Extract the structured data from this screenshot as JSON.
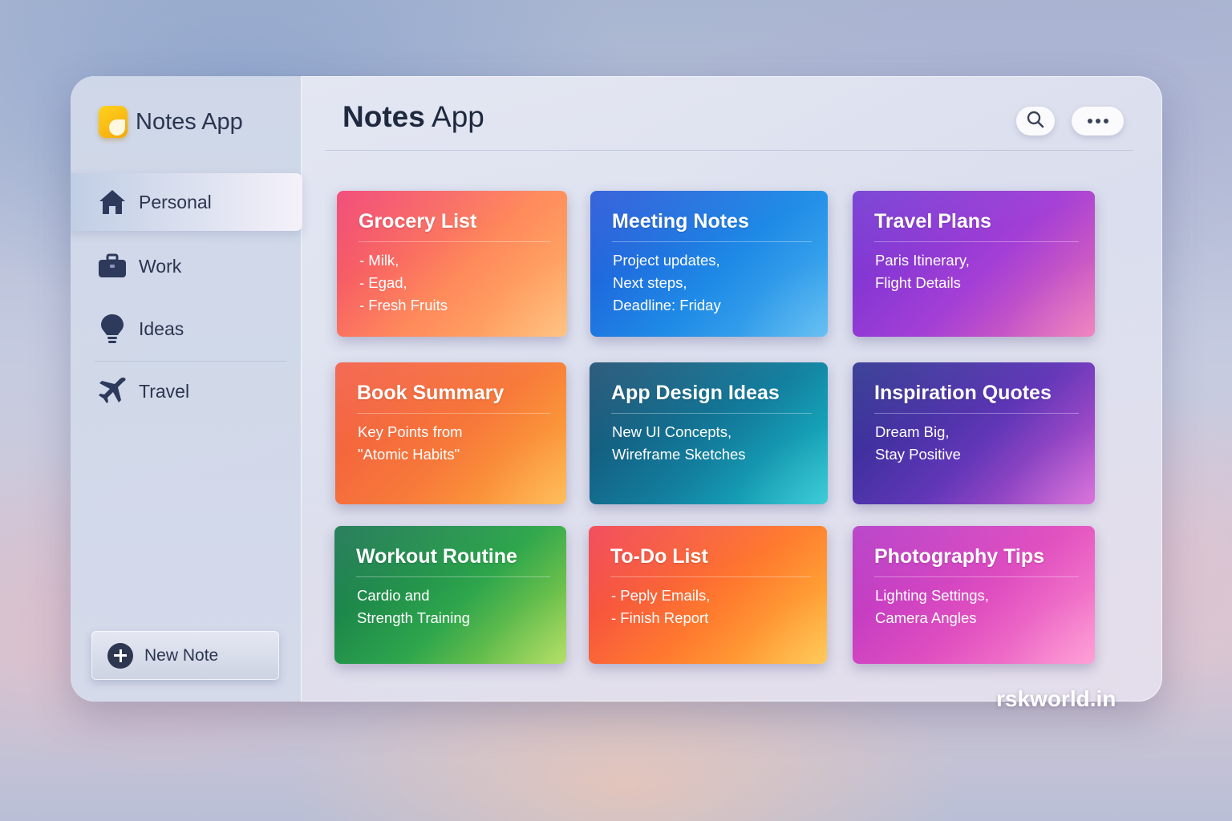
{
  "app": {
    "sidebar_title": "Notes App",
    "header_title_bold": "Notes",
    "header_title_rest": " App"
  },
  "sidebar": {
    "items": [
      {
        "label": "Personal",
        "icon": "home-icon",
        "active": true
      },
      {
        "label": "Work",
        "icon": "briefcase-icon",
        "active": false
      },
      {
        "label": "Ideas",
        "icon": "lightbulb-icon",
        "active": false
      },
      {
        "label": "Travel",
        "icon": "airplane-icon",
        "active": false
      }
    ],
    "new_note_label": "New Note"
  },
  "toolbar": {
    "search_icon": "search-icon",
    "more_icon": "more-icon"
  },
  "notes": [
    {
      "title": "Grocery List",
      "lines": [
        "- Milk,",
        "- Egad,",
        "- Fresh Fruits"
      ],
      "colors": [
        "#f0386b",
        "#ff8a5b",
        "#ffb86a"
      ]
    },
    {
      "title": "Meeting Notes",
      "lines": [
        "Project updates,",
        "Next steps,",
        "Deadline: Friday"
      ],
      "colors": [
        "#1f4fd6",
        "#1f8ae6",
        "#4ab4f0"
      ]
    },
    {
      "title": "Travel Plans",
      "lines": [
        "Paris Itinerary,",
        "Flight Details"
      ],
      "colors": [
        "#6b2fd0",
        "#a43fd6",
        "#ee6fb3"
      ]
    },
    {
      "title": "Book Summary",
      "lines": [
        "Key Points from",
        "\"Atomic Habits\""
      ],
      "colors": [
        "#f2563f",
        "#f77a3a",
        "#ffb13b"
      ]
    },
    {
      "title": "App Design Ideas",
      "lines": [
        "New UI Concepts,",
        "Wireframe Sketches"
      ],
      "colors": [
        "#14476b",
        "#137e9e",
        "#18c3cf"
      ]
    },
    {
      "title": "Inspiration Quotes",
      "lines": [
        "Dream Big,",
        "Stay Positive"
      ],
      "colors": [
        "#232a8a",
        "#6237b8",
        "#d35ad4"
      ]
    },
    {
      "title": "Workout Routine",
      "lines": [
        "Cardio and",
        "Strength Training"
      ],
      "colors": [
        "#0e6e49",
        "#2ea64c",
        "#a6d94a"
      ]
    },
    {
      "title": "To-Do List",
      "lines": [
        "- Peply Emails,",
        "- Finish Report"
      ],
      "colors": [
        "#f0384a",
        "#ff7a2e",
        "#ffc03a"
      ]
    },
    {
      "title": "Photography Tips",
      "lines": [
        "Lighting Settings,",
        "Camera Angles"
      ],
      "colors": [
        "#b12fc4",
        "#e04fc0",
        "#ff8fcf"
      ]
    }
  ],
  "watermark": "rskworld.in"
}
